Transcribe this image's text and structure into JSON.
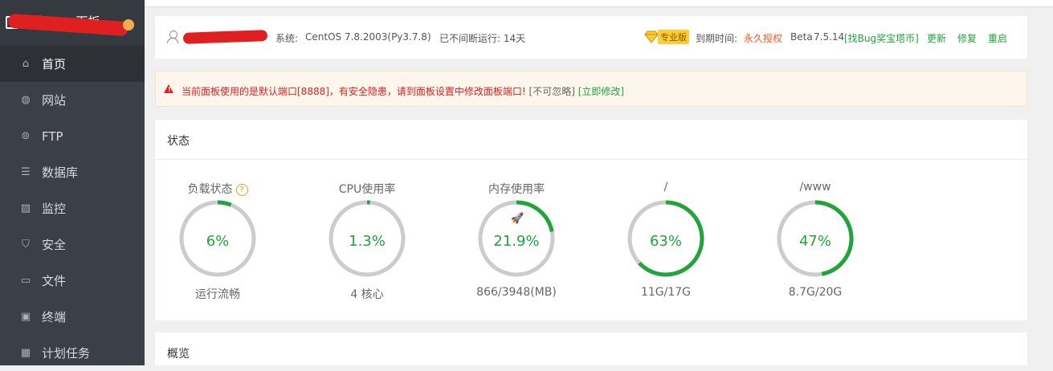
{
  "sidebar": {
    "brand_name": "宝塔Linux面板",
    "items": [
      {
        "label": "首页",
        "icon": "home-icon",
        "active": true
      },
      {
        "label": "网站",
        "icon": "globe-icon"
      },
      {
        "label": "FTP",
        "icon": "ftp-icon"
      },
      {
        "label": "数据库",
        "icon": "database-icon"
      },
      {
        "label": "监控",
        "icon": "monitor-icon"
      },
      {
        "label": "安全",
        "icon": "shield-icon"
      },
      {
        "label": "文件",
        "icon": "folder-icon"
      },
      {
        "label": "终端",
        "icon": "terminal-icon"
      },
      {
        "label": "计划任务",
        "icon": "calendar-icon"
      }
    ]
  },
  "header": {
    "system_label": "系统:",
    "system_value": "CentOS 7.8.2003(Py3.7.8)",
    "uptime": "已不间断运行: 14天",
    "pro_badge": "专业版",
    "expire_label": "到期时间:",
    "expire_value": "永久授权",
    "version_label": "Beta",
    "version": "7.5.14",
    "bug_link": "[找Bug奖宝塔币]",
    "update": "更新",
    "repair": "修复",
    "restart": "重启"
  },
  "warning": {
    "text": "当前面板使用的是默认端口[8888]，有安全隐患，请到面板设置中修改面板端口!",
    "ignore": "[不可忽略]",
    "fix": "[立即修改]"
  },
  "status": {
    "title": "状态",
    "gauges": [
      {
        "title": "负载状态",
        "value": "6%",
        "percent": 6,
        "sub": "运行流畅",
        "help": "?"
      },
      {
        "title": "CPU使用率",
        "value": "1.3%",
        "percent": 1.3,
        "sub": "4 核心"
      },
      {
        "title": "内存使用率",
        "value": "21.9%",
        "percent": 21.9,
        "sub": "866/3948(MB)"
      },
      {
        "title": "/",
        "value": "63%",
        "percent": 63,
        "sub": "11G/17G"
      },
      {
        "title": "/www",
        "value": "47%",
        "percent": 47,
        "sub": "8.7G/20G"
      }
    ]
  },
  "overview": {
    "title": "概览"
  },
  "colors": {
    "accent": "#20a53a",
    "warning": "#e02020",
    "sidebar": "#3b4048"
  }
}
